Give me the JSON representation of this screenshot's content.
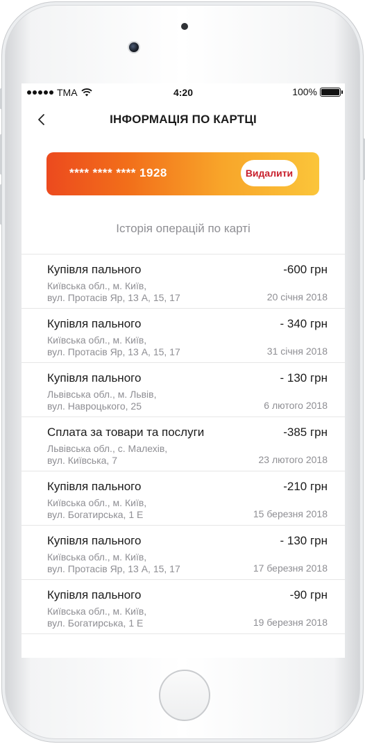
{
  "status_bar": {
    "carrier": "TMA",
    "time": "4:20",
    "battery": "100%"
  },
  "nav": {
    "title": "ІНФОРМАЦІЯ ПО КАРТЦІ"
  },
  "card": {
    "number": "**** **** **** 1928",
    "delete_label": "Видалити"
  },
  "history": {
    "title": "Історія операцій по карті",
    "items": [
      {
        "title": "Купівля пального",
        "amount": "-600 грн",
        "addr1": "Київська обл., м. Київ,",
        "addr2": "вул. Протасів Яр, 13 А, 15, 17",
        "date": "20 січня 2018"
      },
      {
        "title": "Купівля пального",
        "amount": "- 340 грн",
        "addr1": "Київська обл., м. Київ,",
        "addr2": "вул. Протасів Яр, 13 А, 15, 17",
        "date": "31 січня 2018"
      },
      {
        "title": "Купівля пального",
        "amount": "- 130 грн",
        "addr1": "Львівська обл., м. Львів,",
        "addr2": "вул. Навроцького, 25",
        "date": "6 лютого 2018"
      },
      {
        "title": "Сплата за товари та послуги",
        "amount": "-385 грн",
        "addr1": "Львівська обл., с. Малехів,",
        "addr2": "вул. Київська, 7",
        "date": "23 лютого 2018"
      },
      {
        "title": "Купівля пального",
        "amount": "-210 грн",
        "addr1": "Київська обл., м. Київ,",
        "addr2": "вул. Богатирська, 1 Е",
        "date": "15 березня 2018"
      },
      {
        "title": "Купівля пального",
        "amount": "- 130 грн",
        "addr1": "Київська обл., м. Київ,",
        "addr2": "вул. Протасів Яр, 13 А, 15, 17",
        "date": "17 березня 2018"
      },
      {
        "title": "Купівля пального",
        "amount": "-90 грн",
        "addr1": "Київська обл., м. Київ,",
        "addr2": "вул. Богатирська, 1 Е",
        "date": "19 березня 2018"
      }
    ]
  },
  "colors": {
    "card_gradient_start": "#ec4a1e",
    "card_gradient_end": "#fbc53a",
    "delete_text": "#c81e2b",
    "secondary_text": "#8e8e93"
  },
  "icons": {
    "back": "chevron-left-icon",
    "wifi": "wifi-icon",
    "battery": "battery-icon",
    "signal": "signal-dots-icon"
  }
}
